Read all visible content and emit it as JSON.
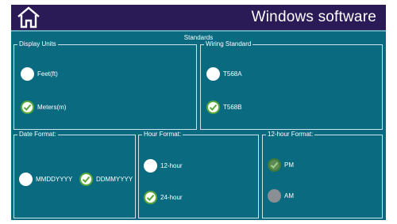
{
  "header": {
    "title": "Windows software",
    "home_icon": "home-icon",
    "background": "#2a1a55"
  },
  "page": {
    "title": "Standards",
    "background": "#0a6b80"
  },
  "display_units": {
    "label": "Display Units",
    "options": [
      {
        "label": "Feet(ft)",
        "selected": false
      },
      {
        "label": "Meters(m)",
        "selected": true
      }
    ]
  },
  "wiring_standard": {
    "label": "Wiring Standard",
    "options": [
      {
        "label": "T568A",
        "selected": false
      },
      {
        "label": "T568B",
        "selected": true
      }
    ]
  },
  "date_format": {
    "label": "Date Format:",
    "options": [
      {
        "label": "MMDDYYYY",
        "selected": false
      },
      {
        "label": "DDMMYYYY",
        "selected": true
      }
    ]
  },
  "hour_format": {
    "label": "Hour Format:",
    "options": [
      {
        "label": "12-hour",
        "selected": false
      },
      {
        "label": "24-hour",
        "selected": true
      }
    ]
  },
  "twelve_hour_format": {
    "label": "12-hour Format:",
    "options": [
      {
        "label": "PM",
        "selected": true,
        "disabled": true
      },
      {
        "label": "AM",
        "selected": false,
        "disabled": true
      }
    ]
  },
  "colors": {
    "check_active": "#57a83a",
    "check_disabled": "#5d8a55",
    "radio_disabled": "#8a8f93"
  }
}
